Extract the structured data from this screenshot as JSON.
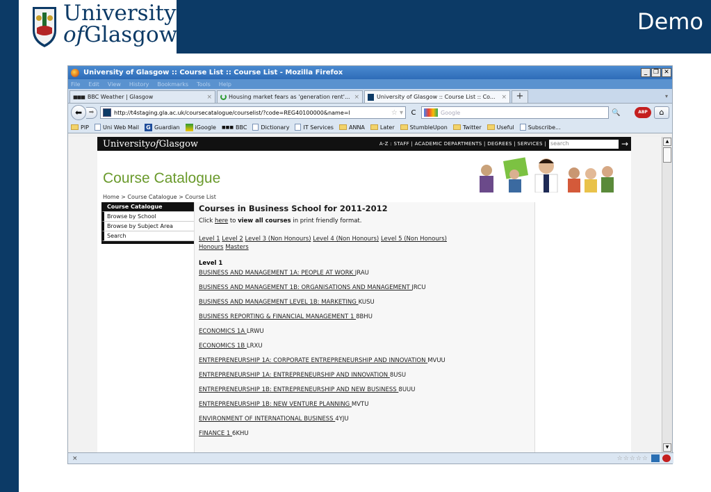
{
  "slide": {
    "title": "Demo",
    "logo_line1": "University",
    "logo_of": "of",
    "logo_line2": "Glasgow"
  },
  "browser": {
    "window_title": "University of Glasgow :: Course List :: Course List - Mozilla Firefox",
    "menu": [
      "File",
      "Edit",
      "View",
      "History",
      "Bookmarks",
      "Tools",
      "Help"
    ],
    "tabs": [
      {
        "label": "BBC Weather | Glasgow"
      },
      {
        "label": "Housing market fears as 'generation rent'..."
      },
      {
        "label": "University of Glasgow :: Course List :: Co..."
      }
    ],
    "url": "http://t4staging.gla.ac.uk/coursecatalogue/courselist/?code=REG40100000&name=l",
    "search_placeholder": "Google",
    "bookmarks": [
      "PIP",
      "Uni Web Mail",
      "Guardian",
      "iGoogle",
      "BBC",
      "Dictionary",
      "IT Services",
      "ANNA",
      "Later",
      "StumbleUpon",
      "Twitter",
      "Useful",
      "Subscribe..."
    ],
    "status_close": "×",
    "stars": "☆☆☆☆☆"
  },
  "site": {
    "logo_a": "University",
    "logo_of": "of",
    "logo_b": "Glasgow",
    "top_links": "A-Z : STAFF | ACADEMIC DEPARTMENTS | DEGREES | SERVICES |",
    "search_placeholder": "search",
    "banner_title": "Course Catalogue",
    "breadcrumb": "Home > Course Catalogue > Course List",
    "leftnav": [
      "Course Catalogue",
      "Browse by School",
      "Browse by Subject Area",
      "Search"
    ],
    "heading": "Courses in Business School for 2011-2012",
    "intro_pre": "Click ",
    "intro_link": "here",
    "intro_mid": " to ",
    "intro_bold": "view all courses",
    "intro_post": " in print friendly format.",
    "level_links": [
      "Level 1",
      "Level 2",
      "Level 3 (Non Honours)",
      "Level 4 (Non Honours)",
      "Level 5 (Non Honours)",
      "Honours",
      "Masters"
    ],
    "level_heading": "Level 1",
    "courses": [
      {
        "name": "BUSINESS AND MANAGEMENT 1A: PEOPLE AT WORK ",
        "code": "JRAU"
      },
      {
        "name": "BUSINESS AND MANAGEMENT 1B: ORGANISATIONS AND MANAGEMENT ",
        "code": "JRCU"
      },
      {
        "name": "BUSINESS AND MANAGEMENT LEVEL 1B: MARKETING ",
        "code": "KUSU"
      },
      {
        "name": "BUSINESS REPORTING & FINANCIAL MANAGEMENT 1 ",
        "code": "8BHU"
      },
      {
        "name": "ECONOMICS 1A ",
        "code": "LRWU"
      },
      {
        "name": "ECONOMICS 1B ",
        "code": "LRXU"
      },
      {
        "name": "ENTREPRENEURSHIP 1A: CORPORATE ENTREPRENEURSHIP AND INNOVATION ",
        "code": "MVUU"
      },
      {
        "name": "ENTREPRENEURSHIP 1A: ENTREPRENEURSHIP AND INNOVATION ",
        "code": "8USU"
      },
      {
        "name": "ENTREPRENEURSHIP 1B: ENTREPRENEURSHIP AND NEW BUSINESS ",
        "code": "8UUU"
      },
      {
        "name": "ENTREPRENEURSHIP 1B: NEW VENTURE PLANNING ",
        "code": "MVTU"
      },
      {
        "name": "ENVIRONMENT OF INTERNATIONAL BUSINESS ",
        "code": "4YJU"
      },
      {
        "name": "FINANCE 1 ",
        "code": "6KHU"
      }
    ]
  }
}
